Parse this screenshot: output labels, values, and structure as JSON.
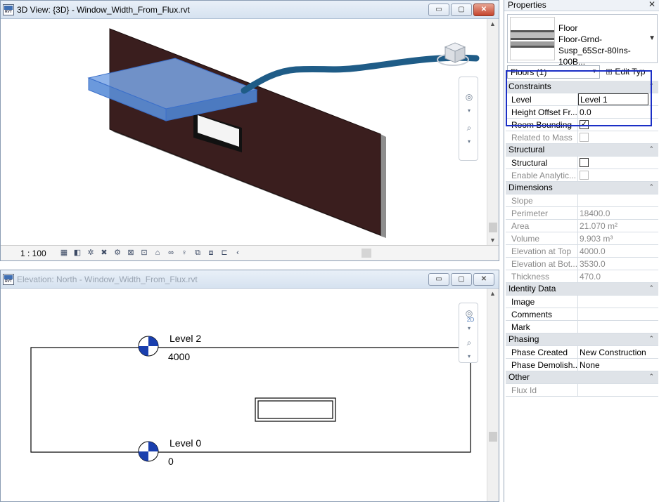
{
  "view3d": {
    "title": "3D View: {3D} - Window_Width_From_Flux.rvt",
    "scale": "1 : 100",
    "window_buttons": [
      "▭",
      "▢",
      "✕"
    ]
  },
  "elevation": {
    "title": "Elevation: North - Window_Width_From_Flux.rvt",
    "window_buttons": [
      "▭",
      "▢",
      "✕"
    ],
    "nav_2d": "2D",
    "levels": [
      {
        "name": "Level 2",
        "elevation": "4000"
      },
      {
        "name": "Level 0",
        "elevation": "0"
      }
    ]
  },
  "properties": {
    "title": "Properties",
    "close": "✕",
    "type_family": "Floor",
    "type_line1": "Floor-Grnd-",
    "type_line2": "Susp_65Scr-80Ins-100B...",
    "filter": "Floors (1)",
    "edit_type": "Edit Typ",
    "groups": {
      "constraints": "Constraints",
      "structural": "Structural",
      "dimensions": "Dimensions",
      "identity": "Identity Data",
      "phasing": "Phasing",
      "other": "Other"
    },
    "params": {
      "level": {
        "name": "Level",
        "value": "Level 1"
      },
      "height_offset": {
        "name": "Height Offset Fr...",
        "value": "0.0"
      },
      "room_bounding": {
        "name": "Room Bounding",
        "value": "✓"
      },
      "related_mass": {
        "name": "Related to Mass",
        "value": ""
      },
      "structural": {
        "name": "Structural",
        "value": ""
      },
      "analytic": {
        "name": "Enable Analytic...",
        "value": ""
      },
      "slope": {
        "name": "Slope",
        "value": ""
      },
      "perimeter": {
        "name": "Perimeter",
        "value": "18400.0"
      },
      "area": {
        "name": "Area",
        "value": "21.070 m²"
      },
      "volume": {
        "name": "Volume",
        "value": "9.903 m³"
      },
      "elev_top": {
        "name": "Elevation at Top",
        "value": "4000.0"
      },
      "elev_bot": {
        "name": "Elevation at Bot...",
        "value": "3530.0"
      },
      "thickness": {
        "name": "Thickness",
        "value": "470.0"
      },
      "image": {
        "name": "Image",
        "value": ""
      },
      "comments": {
        "name": "Comments",
        "value": ""
      },
      "mark": {
        "name": "Mark",
        "value": ""
      },
      "phase_created": {
        "name": "Phase Created",
        "value": "New Construction"
      },
      "phase_demolished": {
        "name": "Phase Demolish...",
        "value": "None"
      },
      "flux_id": {
        "name": "Flux Id",
        "value": ""
      }
    }
  },
  "colors": {
    "wall": "#3a1e1e",
    "floor_highlight": "#6f9be0",
    "arrow": "#1f5c87",
    "selection_box": "#1b2fc6"
  }
}
